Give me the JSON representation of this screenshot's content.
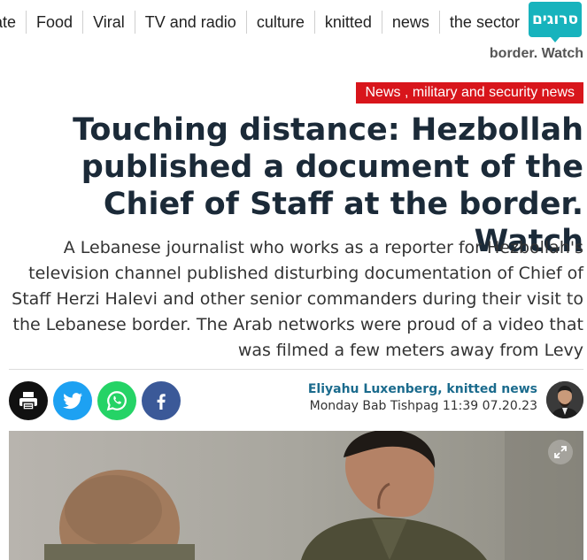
{
  "nav": {
    "items": [
      "ate",
      "Food",
      "Viral",
      "TV and radio",
      "culture",
      "knitted",
      "news",
      "the sector"
    ],
    "logo_text": "סרוגים",
    "logo_color": "#17b3bd"
  },
  "sticky_title": "border. Watch",
  "article": {
    "category": "News , military and security news",
    "category_color": "#d8151b",
    "headline": "Touching distance: Hezbollah published a document of the Chief of Staff at the border. Watch",
    "subtitle": "A Lebanese journalist who works as a reporter for Hezbollah's television channel published disturbing documentation of Chief of Staff Herzi Halevi and other senior commanders during their visit to the Lebanese border. The Arab networks were proud of a video that was filmed a few meters away from Levy",
    "author": "Eliyahu Luxenberg, knitted news",
    "date": "Monday Bab Tishpag 11:39 07.20.23"
  },
  "share": {
    "buttons": [
      {
        "icon": "print-icon",
        "color": "#111111"
      },
      {
        "icon": "twitter-icon",
        "color": "#1da1f2"
      },
      {
        "icon": "whatsapp-icon",
        "color": "#25d366"
      },
      {
        "icon": "facebook-icon",
        "color": "#3b5998"
      }
    ]
  },
  "hero": {
    "icon": "expand-icon"
  }
}
